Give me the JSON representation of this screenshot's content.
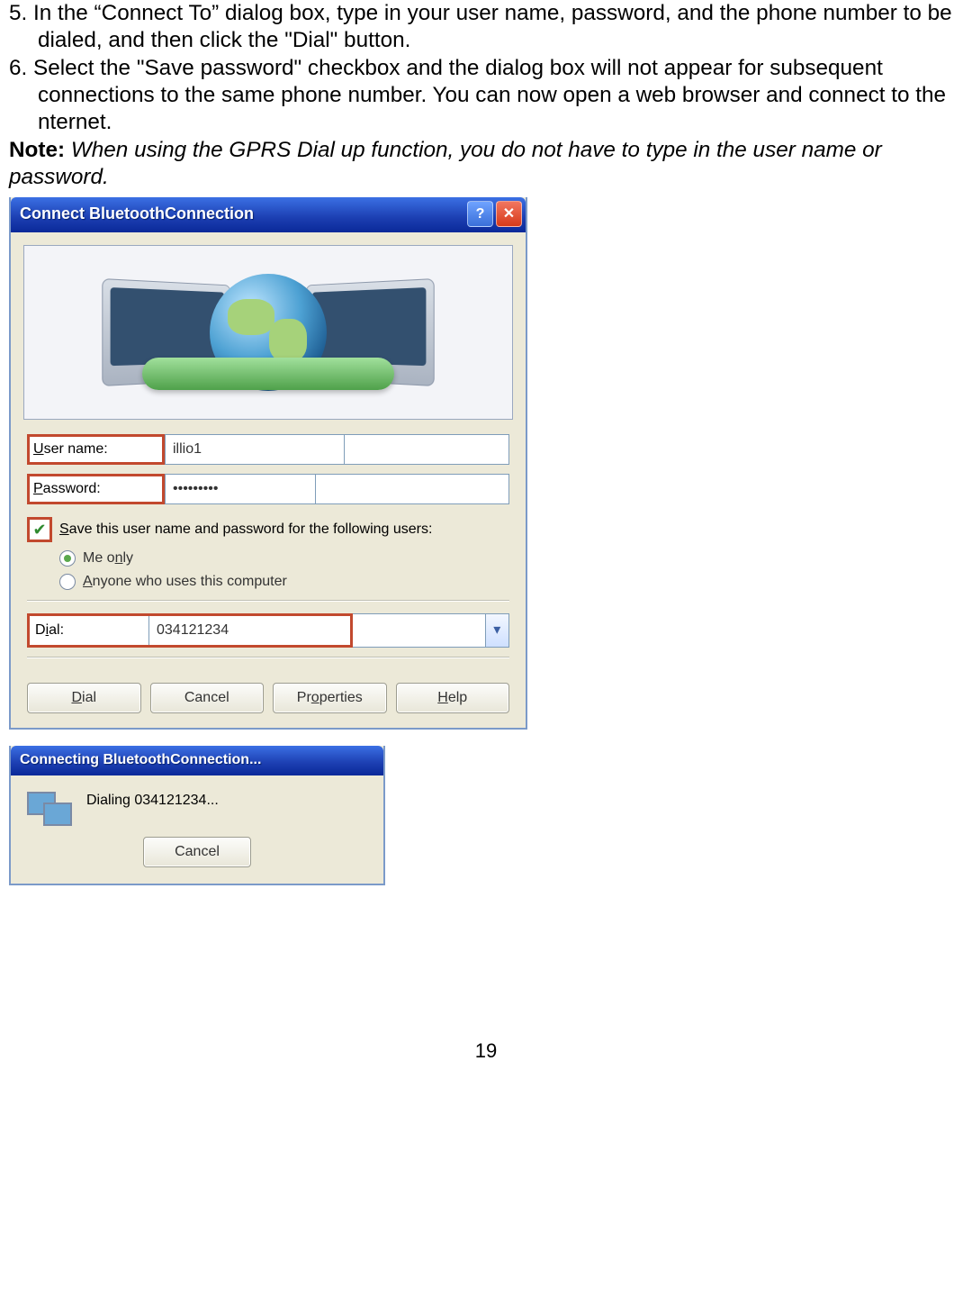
{
  "instructions": {
    "step5_first": "5. In the “Connect To” dialog box, type in your user name, password, and the phone number to be",
    "step5_cont": "dialed, and then click the \"Dial\" button.",
    "step6_first": "6. Select the \"Save password\" checkbox and the dialog box will not appear for subsequent",
    "step6_cont1": "connections to the same phone number. You can now open a web browser and connect to the",
    "step6_cont2": "nternet.",
    "note_label": "Note:",
    "note_text": " When using the GPRS Dial up function, you do not have to type in the user name or",
    "note_text2": "password."
  },
  "dialog1": {
    "title": "Connect BluetoothConnection",
    "username_label": "User name:",
    "username_value": "illio1",
    "password_label": "Password:",
    "password_value": "•••••••••",
    "save_label": "Save this user name and password for the following users:",
    "radio_me": "Me only",
    "radio_anyone": "Anyone who uses this computer",
    "dial_label": "Dial:",
    "dial_value": "034121234",
    "btn_dial": "Dial",
    "btn_cancel": "Cancel",
    "btn_props": "Properties",
    "btn_help": "Help"
  },
  "dialog2": {
    "title": "Connecting BluetoothConnection...",
    "status": "Dialing 034121234...",
    "btn_cancel": "Cancel"
  },
  "page_number": "19"
}
